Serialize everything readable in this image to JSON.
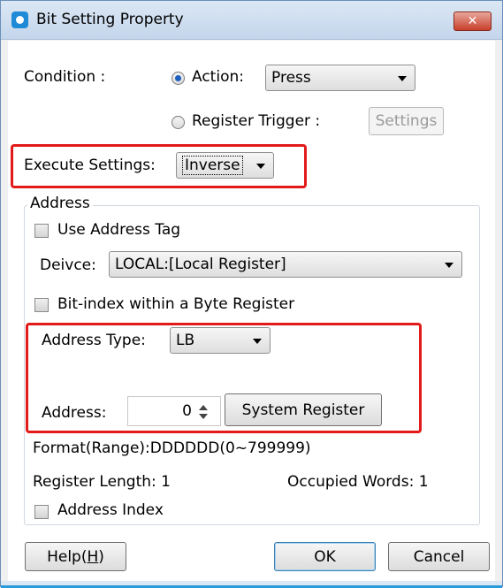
{
  "window": {
    "title": "Bit Setting Property",
    "close_label": "✕"
  },
  "condition": {
    "label": "Condition :",
    "action_label": "Action:",
    "action_value": "Press",
    "register_trigger_label": "Register Trigger :",
    "settings_button": "Settings"
  },
  "execute": {
    "label": "Execute Settings:",
    "value": "Inverse"
  },
  "address_group": {
    "legend": "Address",
    "use_address_tag": "Use Address Tag",
    "device_label": "Deivce:",
    "device_value": "LOCAL:[Local Register]",
    "bit_index_label": "Bit-index within a Byte Register",
    "address_type_label": "Address Type:",
    "address_type_value": "LB",
    "address_label": "Address:",
    "address_value": "0",
    "system_register_button": "System Register",
    "format_text": "Format(Range):DDDDDD(0~799999)",
    "register_length": "Register Length: 1",
    "occupied_words": "Occupied Words: 1",
    "address_index": "Address Index"
  },
  "buttons": {
    "help_prefix": "Help(",
    "help_key": "H",
    "help_suffix": ")",
    "ok": "OK",
    "cancel": "Cancel"
  },
  "colors": {
    "highlight_box": "#e21a1a",
    "accent": "#1f5fbf"
  },
  "icons": [
    "app-icon",
    "close-icon",
    "dropdown-arrow-icon",
    "spin-up-icon",
    "spin-down-icon"
  ]
}
